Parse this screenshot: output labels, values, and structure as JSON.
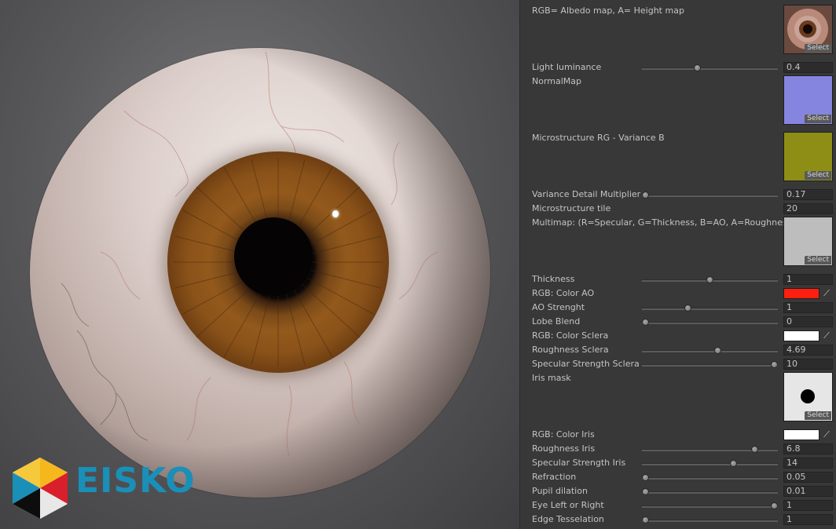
{
  "logo": {
    "text": "EISKO"
  },
  "panel": {
    "textures": [
      {
        "id": "albedo",
        "label": "RGB= Albedo map, A= Height map",
        "select_label": "Select"
      },
      {
        "id": "normal",
        "label": "NormalMap",
        "select_label": "Select",
        "color": "#8585e0"
      },
      {
        "id": "micro",
        "label": "Microstructure RG - Variance B",
        "select_label": "Select",
        "color": "#8e8e16"
      },
      {
        "id": "multimap",
        "label": "Multimap: (R=Specular, G=Thickness, B=AO, A=Roughness)",
        "select_label": "Select",
        "color": "#bdbdbd"
      },
      {
        "id": "irismask",
        "label": "Iris mask",
        "select_label": "Select",
        "color": "#e6e6e6"
      }
    ],
    "sliders": [
      {
        "id": "light-luminance",
        "label": "Light luminance",
        "value": "0.4",
        "pos": 0.4
      },
      {
        "id": "variance-detail",
        "label": "Variance Detail Multiplier",
        "value": "0.17",
        "pos": 0.0
      },
      {
        "id": "thickness",
        "label": "Thickness",
        "value": "1",
        "pos": 0.5
      },
      {
        "id": "ao-strength",
        "label": "AO Strenght",
        "value": "1",
        "pos": 0.33
      },
      {
        "id": "lobe-blend",
        "label": "Lobe Blend",
        "value": "0",
        "pos": 0.0
      },
      {
        "id": "roughness-sclera",
        "label": "Roughness Sclera",
        "value": "4.69",
        "pos": 0.56
      },
      {
        "id": "specular-sclera",
        "label": "Specular Strength Sclera",
        "value": "10",
        "pos": 1.0
      },
      {
        "id": "roughness-iris",
        "label": "Roughness Iris",
        "value": "6.8",
        "pos": 0.85
      },
      {
        "id": "specular-iris",
        "label": "Specular Strength Iris",
        "value": "14",
        "pos": 0.68
      },
      {
        "id": "refraction",
        "label": "Refraction",
        "value": "0.05",
        "pos": 0.0
      },
      {
        "id": "pupil-dilation",
        "label": "Pupil dilation",
        "value": "0.01",
        "pos": 0.0
      },
      {
        "id": "eye-left-right",
        "label": "Eye Left or Right",
        "value": "1",
        "pos": 1.0
      },
      {
        "id": "edge-tesselation",
        "label": "Edge Tesselation",
        "value": "1",
        "pos": 0.0
      }
    ],
    "fields": [
      {
        "id": "microstructure-tile",
        "label": "Microstructure tile",
        "value": "20"
      }
    ],
    "colors": [
      {
        "id": "color-ao",
        "label": "RGB: Color AO",
        "color": "#ff1f10"
      },
      {
        "id": "color-sclera",
        "label": "RGB: Color Sclera",
        "color": "#ffffff"
      },
      {
        "id": "color-iris",
        "label": "RGB: Color Iris",
        "color": "#ffffff"
      }
    ],
    "picker_glyph": "⟋"
  }
}
